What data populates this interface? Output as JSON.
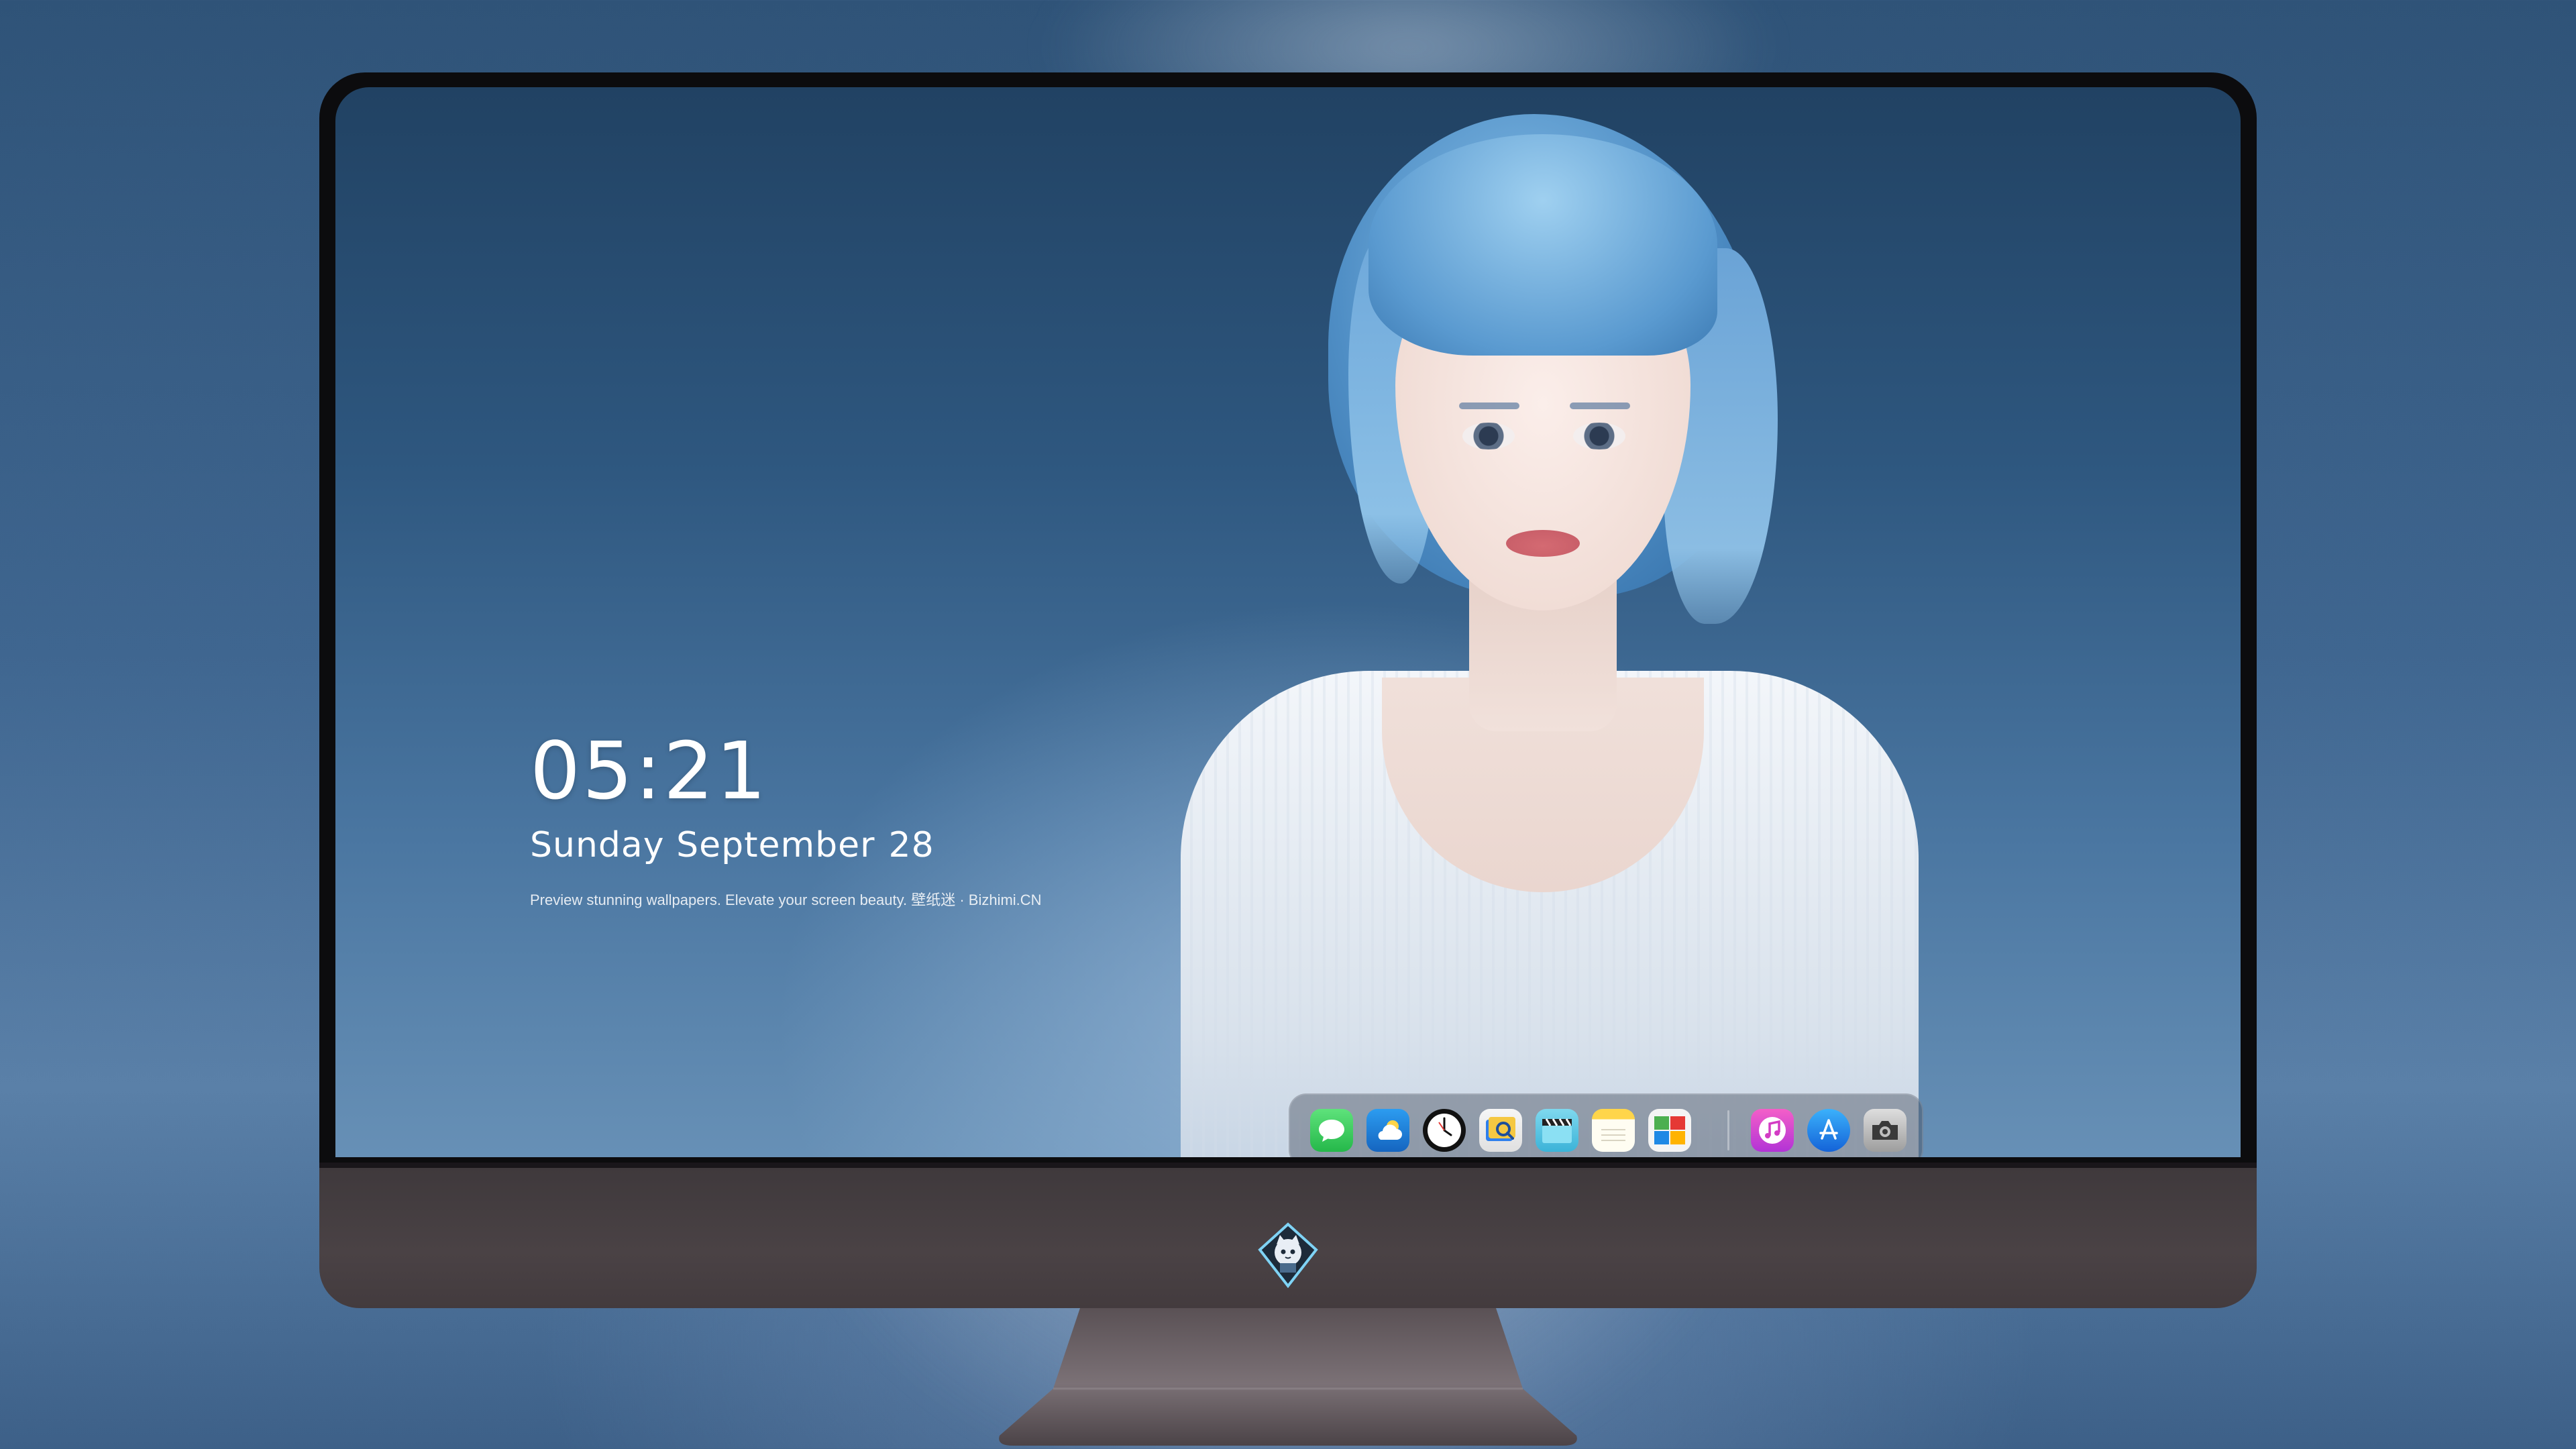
{
  "lock_screen": {
    "time": "05:21",
    "date_weekday_month": "Sunday September",
    "date_day": "28",
    "tagline": "Preview stunning wallpapers. Elevate your screen beauty. 壁纸迷 · Bizhimi.CN"
  },
  "dock": {
    "apps": [
      {
        "name": "messages",
        "icon": "speech-bubble-icon",
        "color": "#34c759"
      },
      {
        "name": "weather",
        "icon": "cloud-sun-icon",
        "color": "#1e88e5"
      },
      {
        "name": "clock",
        "icon": "clock-icon",
        "color": "#ffffff"
      },
      {
        "name": "preview",
        "icon": "photo-viewer-icon",
        "color": "#f5c842"
      },
      {
        "name": "movies",
        "icon": "clapperboard-icon",
        "color": "#5ac8e6"
      },
      {
        "name": "notes",
        "icon": "notepad-icon",
        "color": "#ffd84d"
      },
      {
        "name": "photo-booth",
        "icon": "photo-collage-icon",
        "color": "#f2f2f2"
      },
      {
        "name": "music",
        "icon": "music-note-icon",
        "color": "#e84fc7"
      },
      {
        "name": "app-store",
        "icon": "app-store-icon",
        "color": "#1f8ef1"
      },
      {
        "name": "screenshot",
        "icon": "camera-icon",
        "color": "#d0d0d0"
      }
    ]
  },
  "monitor": {
    "logo": "cat-mascot-logo-icon"
  }
}
